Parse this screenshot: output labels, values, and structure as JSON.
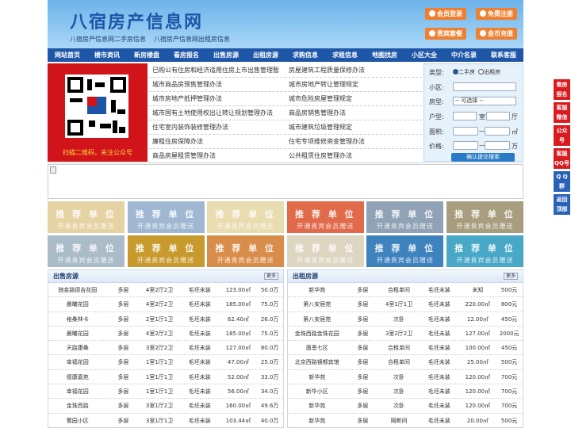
{
  "header": {
    "logo": "八宿房产信息网",
    "slogan1": "八宿房产信息网二手房信息",
    "slogan2": "八宿房产信息网出租房信息",
    "btn_login": "会员登录",
    "btn_register": "免费注册",
    "btn_package": "贵宾套餐",
    "btn_recharge": "金币充值"
  },
  "nav": [
    "网站首页",
    "楼市资讯",
    "新房楼盘",
    "看房报名",
    "出售房源",
    "出租房源",
    "求购信息",
    "求租信息",
    "地图找房",
    "小区大全",
    "中介名录",
    "联系客服"
  ],
  "qr": {
    "text": "扫描二维码，关注公众号"
  },
  "links": [
    [
      "已购公有住房和经济适用住房上市出售管理暂",
      "房屋建筑工程质量保修办法"
    ],
    [
      "城市商品房预售管理办法",
      "城市房地产转让管理规定"
    ],
    [
      "城市房地产抵押管理办法",
      "城市危险房屋管理规定"
    ],
    [
      "城市国有土地使用权出让转让规划管理办法",
      "商品房销售管理办法"
    ],
    [
      "住宅室内装饰装修管理办法",
      "城市建筑垃圾管理规定"
    ],
    [
      "廉租住房保障办法",
      "住宅专项维修资金管理办法"
    ],
    [
      "商品房屋租赁管理办法",
      "公共租赁住房管理办法"
    ]
  ],
  "search": {
    "type_label": "类型:",
    "opt1": "二手房",
    "opt2": "出租房",
    "area_label": "小区:",
    "room_label": "房型:",
    "room_select": "-- 可选择 --",
    "layout_label": "户型:",
    "shi": "室",
    "ting": "厅",
    "size_label": "面积:",
    "size_unit": "㎡",
    "price_label": "价格:",
    "price_unit": "万",
    "submit": "确认提交搜索"
  },
  "ad": {
    "line1": "推 荐 单 位",
    "line2": "开通贵宾会员赠送"
  },
  "ad_colors": [
    "#e6d3a3",
    "#9fb7d1",
    "#e8dcb0",
    "#e06a4a",
    "#8fa2b6",
    "#a99d7f",
    "#a9bcc8",
    "#c89a2e",
    "#d98d4a",
    "#ded6c2",
    "#3f83be",
    "#49a7c7"
  ],
  "sale": {
    "title": "出售房源",
    "more": "更多",
    "rows": [
      [
        "驰金路德吉花园",
        "多层",
        "4室2厅2卫",
        "毛坯未装",
        "123.00㎡",
        "50.0万"
      ],
      [
        "晨曦花园",
        "多层",
        "4室2厅2卫",
        "毛坯未装",
        "185.00㎡",
        "75.0万"
      ],
      [
        "格桑林卡",
        "多层",
        "2室1厅1卫",
        "毛坯未装",
        "62.40㎡",
        "26.0万"
      ],
      [
        "晨曦花园",
        "多层",
        "4室2厅2卫",
        "毛坯未装",
        "185.00㎡",
        "75.0万"
      ],
      [
        "天路康桑",
        "多层",
        "3室2厅2卫",
        "毛坯未装",
        "127.00㎡",
        "80.0万"
      ],
      [
        "幸福花园",
        "多层",
        "1室1厅1卫",
        "毛坯未装",
        "47.00㎡",
        "25.0万"
      ],
      [
        "德康嘉苑",
        "多层",
        "1室1厅1卫",
        "毛坯未装",
        "52.00㎡",
        "33.0万"
      ],
      [
        "幸福花园",
        "多层",
        "1室1厅1卫",
        "毛坯未装",
        "56.00㎡",
        "34.0万"
      ],
      [
        "金珠西路",
        "多层",
        "3室1厅2卫",
        "毛坯未装",
        "160.00㎡",
        "49.6万"
      ],
      [
        "蜀园小区",
        "多层",
        "3室1厅1卫",
        "毛坯未装",
        "103.44㎡",
        "40.0万"
      ]
    ]
  },
  "rent": {
    "title": "出租房源",
    "more": "更多",
    "rows": [
      [
        "新华苑",
        "多层",
        "合租单间",
        "毛坯未装",
        "未知",
        "500元"
      ],
      [
        "第八安居苑",
        "多层",
        "4室1厅1卫",
        "毛坯未装",
        "220.00㎡",
        "800元"
      ],
      [
        "第八安居苑",
        "多层",
        "次卧",
        "毛坯未装",
        "12.00㎡",
        "450元"
      ],
      [
        "金珠西路金珠花园",
        "多层",
        "3室2厅2卫",
        "毛坯未装",
        "127.00㎡",
        "2000元"
      ],
      [
        "茵恩七区",
        "多层",
        "合租单间",
        "毛坯未装",
        "100.00㎡",
        "450元"
      ],
      [
        "北京西路银都宾馆",
        "多层",
        "合租单间",
        "毛坯未装",
        "25.00㎡",
        "500元"
      ],
      [
        "新华苑",
        "多层",
        "次卧",
        "毛坯未装",
        "120.00㎡",
        "700元"
      ],
      [
        "新华小区",
        "多层",
        "次卧",
        "毛坯未装",
        "120.00㎡",
        "700元"
      ],
      [
        "新华苑",
        "多层",
        "次卧",
        "毛坯未装",
        "120.00㎡",
        "700元"
      ],
      [
        "新华苑",
        "多层",
        "隔断间",
        "毛坯未装",
        "20.00㎡",
        "500元"
      ]
    ]
  },
  "side": [
    [
      "看房",
      "报名"
    ],
    [
      "客服",
      "微信"
    ],
    [
      "公众",
      "号"
    ],
    [
      "客服",
      "QQ号"
    ],
    [
      "Q Q",
      "群"
    ],
    [
      "返回",
      "顶部"
    ]
  ]
}
